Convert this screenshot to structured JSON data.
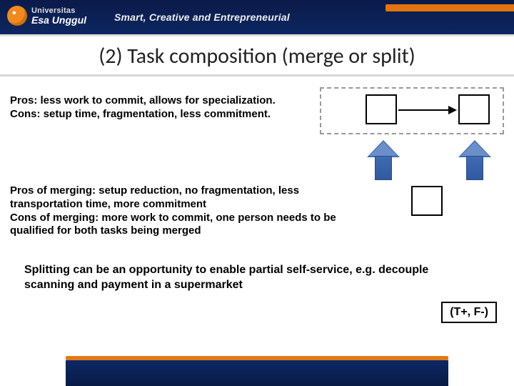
{
  "header": {
    "logo_sub": "Universitas",
    "logo_name": "Esa Unggul",
    "tagline": "Smart, Creative and Entrepreneurial"
  },
  "title": "(2) Task composition (merge or split)",
  "block1": {
    "l1": "Pros: less work to commit, allows for specialization.",
    "l2": "Cons: setup time, fragmentation, less commitment."
  },
  "block2": {
    "l1": "Pros of merging: setup reduction, no fragmentation, less transportation time, more commitment",
    "l2": "Cons of merging: more work to commit, one person needs to be qualified for both tasks being merged"
  },
  "split_text": "Splitting can be an opportunity to enable partial self-service, e.g. decouple scanning and payment in a supermarket",
  "badge": "(T+, F-)",
  "icons": {
    "up1": "up-arrow-icon",
    "up2": "up-arrow-icon",
    "right": "right-arrow-icon"
  }
}
